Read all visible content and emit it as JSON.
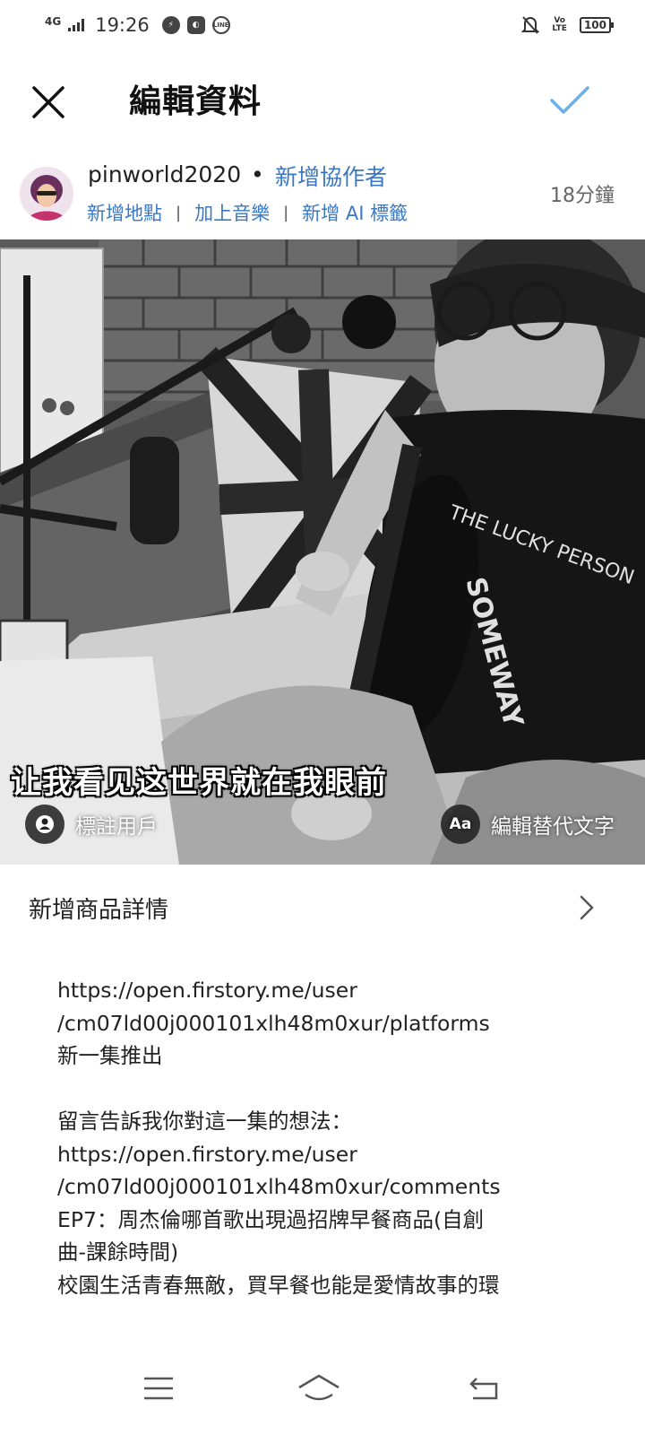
{
  "status_bar": {
    "network": "4G",
    "time": "19:26",
    "volte": "VoLTE",
    "battery": "100"
  },
  "header": {
    "title": "編輯資料",
    "close_icon": "close-icon",
    "confirm_icon": "checkmark-icon",
    "accent_color": "#6ab0e8"
  },
  "account": {
    "username": "pinworld2020",
    "separator": "•",
    "add_collaborator": "新增協作者",
    "time_ago": "18分鐘",
    "links": {
      "location": "新增地點",
      "music": "加上音樂",
      "ai_label": "新增 AI 標籤"
    },
    "link_color": "#3a78c3"
  },
  "media": {
    "subtitle": "让我看见这世界就在我眼前",
    "tag_people": "標註用戶",
    "alt_text_icon": "Aa",
    "edit_alt_text": "編輯替代文字"
  },
  "product": {
    "label": "新增商品詳情"
  },
  "caption": {
    "lines": [
      "https://open.firstory.me/user",
      "/cm07ld00j000101xlh48m0xur/platforms",
      "新一集推出",
      "",
      "留言告訴我你對這一集的想法：",
      "https://open.firstory.me/user",
      "/cm07ld00j000101xlh48m0xur/comments",
      "EP7：周杰倫哪首歌出現過招牌早餐商品(自創",
      "曲-課餘時間)",
      "校園生活青春無敵，買早餐也能是愛情故事的環"
    ]
  },
  "nav_bar": {
    "menu_icon": "menu-icon",
    "home_icon": "home-icon",
    "back_icon": "back-icon"
  }
}
